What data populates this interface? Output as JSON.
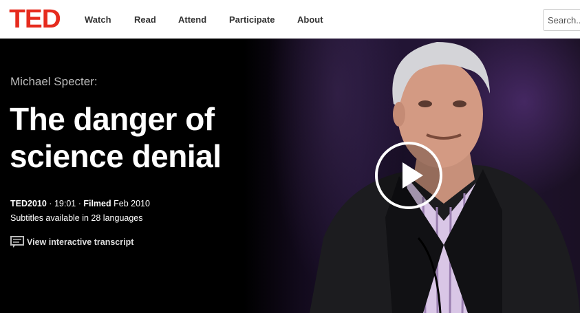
{
  "header": {
    "logo": "TED",
    "nav": [
      "Watch",
      "Read",
      "Attend",
      "Participate",
      "About"
    ],
    "search_placeholder": "Search..."
  },
  "talk": {
    "speaker": "Michael Specter:",
    "title": "The danger of science denial",
    "event": "TED2010",
    "duration": "19:01",
    "filmed_label": "Filmed",
    "filmed_date": "Feb 2010",
    "subtitles": "Subtitles available in 28 languages",
    "transcript_link": "View interactive transcript"
  },
  "colors": {
    "brand": "#e62b1e",
    "hero_bg": "#000000"
  },
  "icons": {
    "transcript": "speech-bubble-icon",
    "play": "play-icon"
  }
}
